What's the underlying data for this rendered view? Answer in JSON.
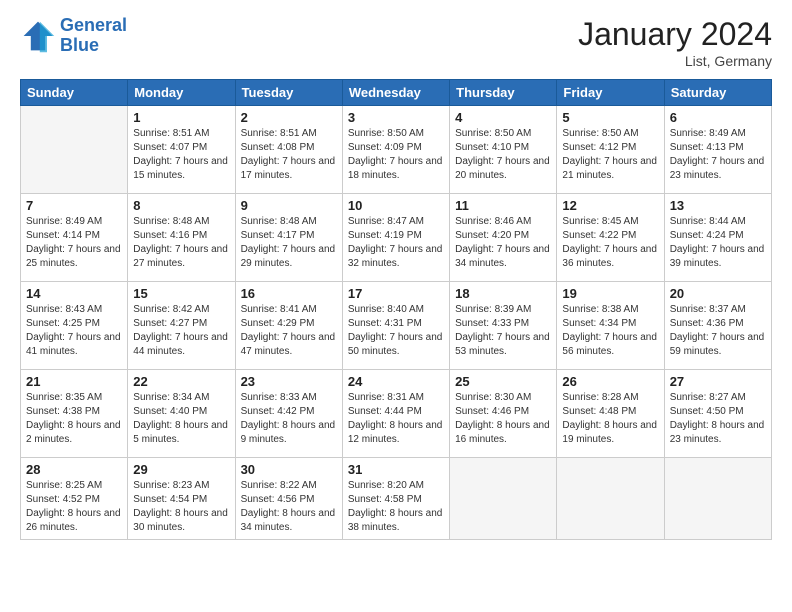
{
  "header": {
    "logo_line1": "General",
    "logo_line2": "Blue",
    "month": "January 2024",
    "location": "List, Germany"
  },
  "weekdays": [
    "Sunday",
    "Monday",
    "Tuesday",
    "Wednesday",
    "Thursday",
    "Friday",
    "Saturday"
  ],
  "weeks": [
    [
      {
        "day": "",
        "sunrise": "",
        "sunset": "",
        "daylight": "",
        "empty": true
      },
      {
        "day": "1",
        "sunrise": "Sunrise: 8:51 AM",
        "sunset": "Sunset: 4:07 PM",
        "daylight": "Daylight: 7 hours and 15 minutes."
      },
      {
        "day": "2",
        "sunrise": "Sunrise: 8:51 AM",
        "sunset": "Sunset: 4:08 PM",
        "daylight": "Daylight: 7 hours and 17 minutes."
      },
      {
        "day": "3",
        "sunrise": "Sunrise: 8:50 AM",
        "sunset": "Sunset: 4:09 PM",
        "daylight": "Daylight: 7 hours and 18 minutes."
      },
      {
        "day": "4",
        "sunrise": "Sunrise: 8:50 AM",
        "sunset": "Sunset: 4:10 PM",
        "daylight": "Daylight: 7 hours and 20 minutes."
      },
      {
        "day": "5",
        "sunrise": "Sunrise: 8:50 AM",
        "sunset": "Sunset: 4:12 PM",
        "daylight": "Daylight: 7 hours and 21 minutes."
      },
      {
        "day": "6",
        "sunrise": "Sunrise: 8:49 AM",
        "sunset": "Sunset: 4:13 PM",
        "daylight": "Daylight: 7 hours and 23 minutes."
      }
    ],
    [
      {
        "day": "7",
        "sunrise": "Sunrise: 8:49 AM",
        "sunset": "Sunset: 4:14 PM",
        "daylight": "Daylight: 7 hours and 25 minutes."
      },
      {
        "day": "8",
        "sunrise": "Sunrise: 8:48 AM",
        "sunset": "Sunset: 4:16 PM",
        "daylight": "Daylight: 7 hours and 27 minutes."
      },
      {
        "day": "9",
        "sunrise": "Sunrise: 8:48 AM",
        "sunset": "Sunset: 4:17 PM",
        "daylight": "Daylight: 7 hours and 29 minutes."
      },
      {
        "day": "10",
        "sunrise": "Sunrise: 8:47 AM",
        "sunset": "Sunset: 4:19 PM",
        "daylight": "Daylight: 7 hours and 32 minutes."
      },
      {
        "day": "11",
        "sunrise": "Sunrise: 8:46 AM",
        "sunset": "Sunset: 4:20 PM",
        "daylight": "Daylight: 7 hours and 34 minutes."
      },
      {
        "day": "12",
        "sunrise": "Sunrise: 8:45 AM",
        "sunset": "Sunset: 4:22 PM",
        "daylight": "Daylight: 7 hours and 36 minutes."
      },
      {
        "day": "13",
        "sunrise": "Sunrise: 8:44 AM",
        "sunset": "Sunset: 4:24 PM",
        "daylight": "Daylight: 7 hours and 39 minutes."
      }
    ],
    [
      {
        "day": "14",
        "sunrise": "Sunrise: 8:43 AM",
        "sunset": "Sunset: 4:25 PM",
        "daylight": "Daylight: 7 hours and 41 minutes."
      },
      {
        "day": "15",
        "sunrise": "Sunrise: 8:42 AM",
        "sunset": "Sunset: 4:27 PM",
        "daylight": "Daylight: 7 hours and 44 minutes."
      },
      {
        "day": "16",
        "sunrise": "Sunrise: 8:41 AM",
        "sunset": "Sunset: 4:29 PM",
        "daylight": "Daylight: 7 hours and 47 minutes."
      },
      {
        "day": "17",
        "sunrise": "Sunrise: 8:40 AM",
        "sunset": "Sunset: 4:31 PM",
        "daylight": "Daylight: 7 hours and 50 minutes."
      },
      {
        "day": "18",
        "sunrise": "Sunrise: 8:39 AM",
        "sunset": "Sunset: 4:33 PM",
        "daylight": "Daylight: 7 hours and 53 minutes."
      },
      {
        "day": "19",
        "sunrise": "Sunrise: 8:38 AM",
        "sunset": "Sunset: 4:34 PM",
        "daylight": "Daylight: 7 hours and 56 minutes."
      },
      {
        "day": "20",
        "sunrise": "Sunrise: 8:37 AM",
        "sunset": "Sunset: 4:36 PM",
        "daylight": "Daylight: 7 hours and 59 minutes."
      }
    ],
    [
      {
        "day": "21",
        "sunrise": "Sunrise: 8:35 AM",
        "sunset": "Sunset: 4:38 PM",
        "daylight": "Daylight: 8 hours and 2 minutes."
      },
      {
        "day": "22",
        "sunrise": "Sunrise: 8:34 AM",
        "sunset": "Sunset: 4:40 PM",
        "daylight": "Daylight: 8 hours and 5 minutes."
      },
      {
        "day": "23",
        "sunrise": "Sunrise: 8:33 AM",
        "sunset": "Sunset: 4:42 PM",
        "daylight": "Daylight: 8 hours and 9 minutes."
      },
      {
        "day": "24",
        "sunrise": "Sunrise: 8:31 AM",
        "sunset": "Sunset: 4:44 PM",
        "daylight": "Daylight: 8 hours and 12 minutes."
      },
      {
        "day": "25",
        "sunrise": "Sunrise: 8:30 AM",
        "sunset": "Sunset: 4:46 PM",
        "daylight": "Daylight: 8 hours and 16 minutes."
      },
      {
        "day": "26",
        "sunrise": "Sunrise: 8:28 AM",
        "sunset": "Sunset: 4:48 PM",
        "daylight": "Daylight: 8 hours and 19 minutes."
      },
      {
        "day": "27",
        "sunrise": "Sunrise: 8:27 AM",
        "sunset": "Sunset: 4:50 PM",
        "daylight": "Daylight: 8 hours and 23 minutes."
      }
    ],
    [
      {
        "day": "28",
        "sunrise": "Sunrise: 8:25 AM",
        "sunset": "Sunset: 4:52 PM",
        "daylight": "Daylight: 8 hours and 26 minutes."
      },
      {
        "day": "29",
        "sunrise": "Sunrise: 8:23 AM",
        "sunset": "Sunset: 4:54 PM",
        "daylight": "Daylight: 8 hours and 30 minutes."
      },
      {
        "day": "30",
        "sunrise": "Sunrise: 8:22 AM",
        "sunset": "Sunset: 4:56 PM",
        "daylight": "Daylight: 8 hours and 34 minutes."
      },
      {
        "day": "31",
        "sunrise": "Sunrise: 8:20 AM",
        "sunset": "Sunset: 4:58 PM",
        "daylight": "Daylight: 8 hours and 38 minutes."
      },
      {
        "day": "",
        "sunrise": "",
        "sunset": "",
        "daylight": "",
        "empty": true
      },
      {
        "day": "",
        "sunrise": "",
        "sunset": "",
        "daylight": "",
        "empty": true
      },
      {
        "day": "",
        "sunrise": "",
        "sunset": "",
        "daylight": "",
        "empty": true
      }
    ]
  ]
}
